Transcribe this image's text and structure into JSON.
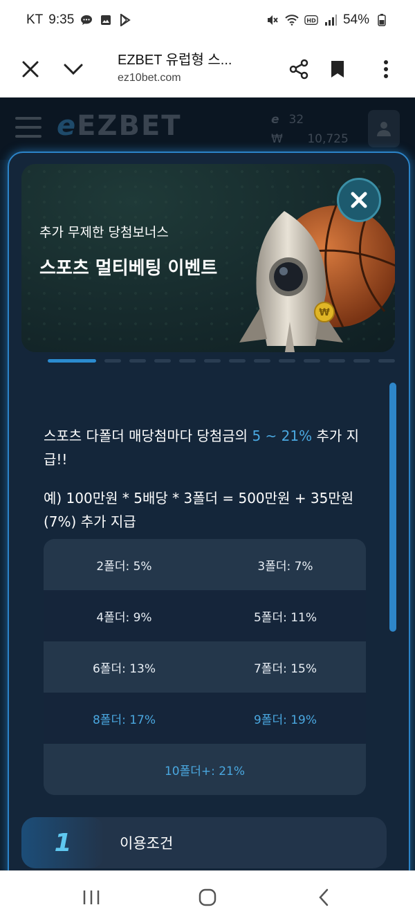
{
  "status_bar": {
    "carrier": "KT",
    "time": "9:35",
    "battery": "54%"
  },
  "browser": {
    "title": "EZBET 유럽형 스...",
    "url": "ez10bet.com"
  },
  "site_header": {
    "logo": "EZBET",
    "points": "32",
    "currency_symbol": "₩",
    "balance": "10,725"
  },
  "modal": {
    "banner": {
      "subtitle": "추가 무제한 당첨보너스",
      "title": "스포츠 멀티베팅 이벤트"
    },
    "pager": {
      "total": 13,
      "active_index": 0
    },
    "description": {
      "before": "스포츠 다폴더 매당첨마다 당첨금의 ",
      "highlight": "5 ~ 21%",
      "after": " 추가 지급!!"
    },
    "example": "예) 100만원 * 5배당 * 3폴더 = 500만원 + 35만원 (7%) 추가 지급",
    "rates": [
      [
        "2폴더: 5%",
        "3폴더: 7%"
      ],
      [
        "4폴더: 9%",
        "5폴더: 11%"
      ],
      [
        "6폴더: 13%",
        "7폴더: 15%"
      ],
      [
        "8폴더: 17%",
        "9폴더: 19%"
      ],
      [
        "10폴더+: 21%"
      ]
    ],
    "terms": {
      "number": "1",
      "label": "이용조건"
    }
  },
  "colors": {
    "accent": "#2b8bcf",
    "highlight_text": "#4aa8e0",
    "modal_bg": "#14263a"
  }
}
